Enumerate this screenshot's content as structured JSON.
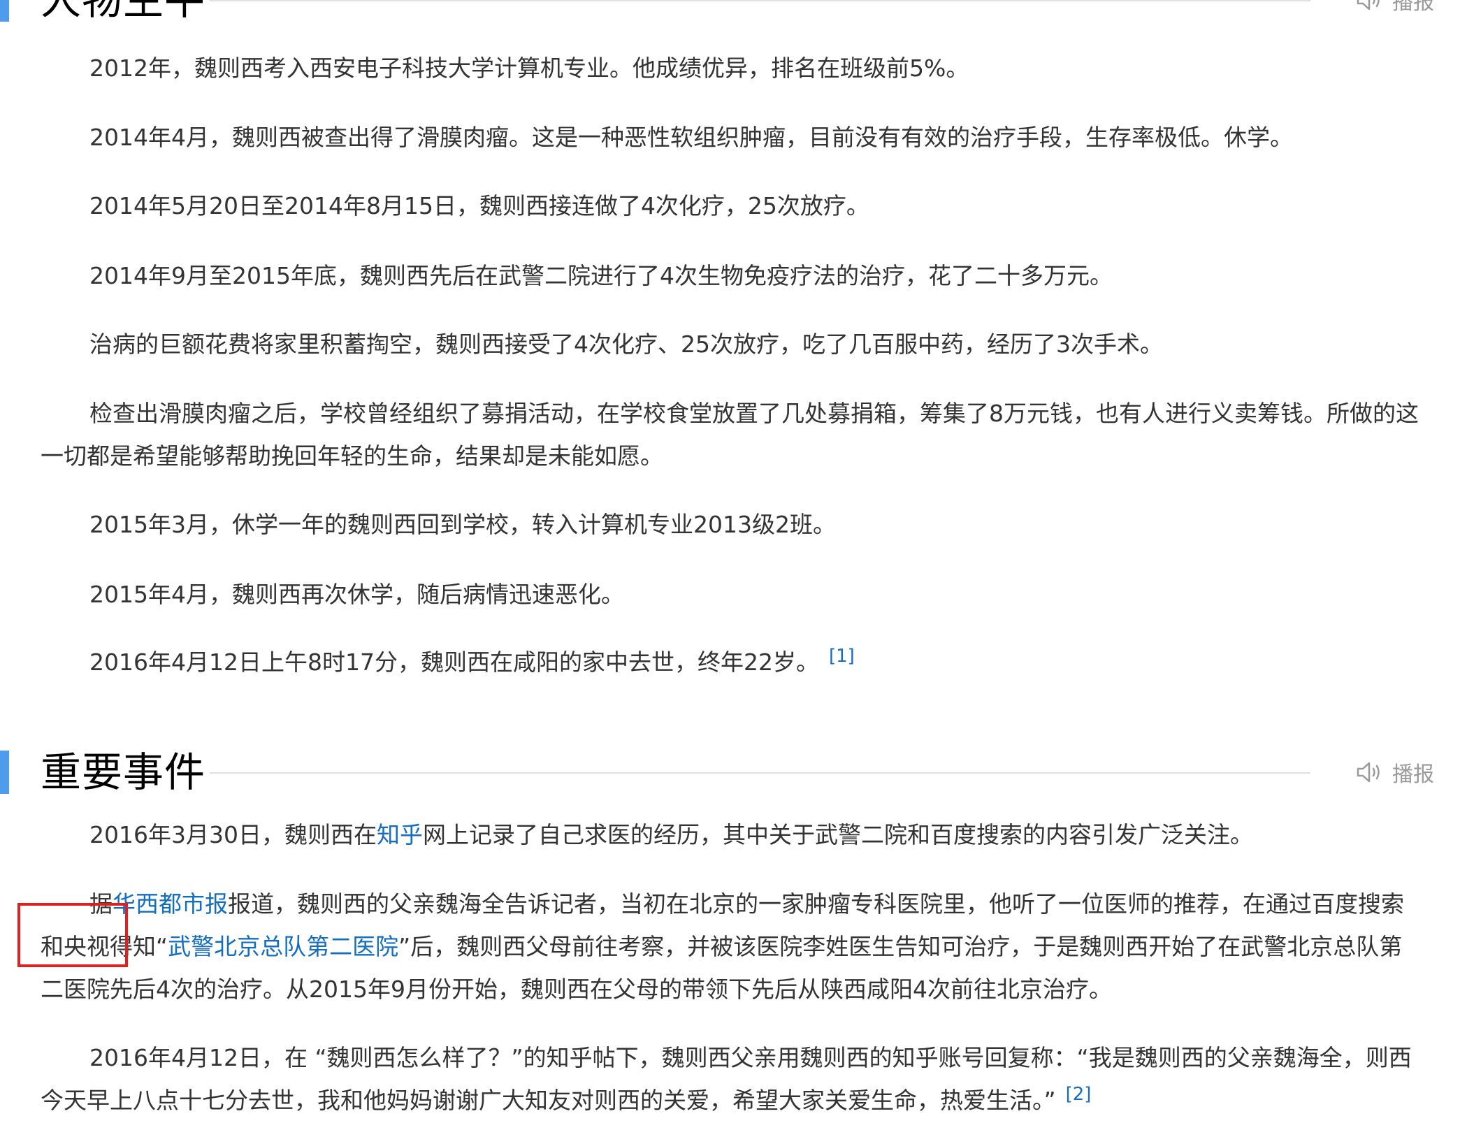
{
  "sections": [
    {
      "title": "人物生平",
      "listen_label": "播报"
    },
    {
      "title": "重要事件",
      "listen_label": "播报"
    }
  ],
  "life": {
    "p1": "2012年，魏则西考入西安电子科技大学计算机专业。他成绩优异，排名在班级前5%。",
    "p2": "2014年4月，魏则西被查出得了滑膜肉瘤。这是一种恶性软组织肿瘤，目前没有有效的治疗手段，生存率极低。休学。",
    "p3": "2014年5月20日至2014年8月15日，魏则西接连做了4次化疗，25次放疗。",
    "p4": "2014年9月至2015年底，魏则西先后在武警二院进行了4次生物免疫疗法的治疗，花了二十多万元。",
    "p5": "治病的巨额花费将家里积蓄掏空，魏则西接受了4次化疗、25次放疗，吃了几百服中药，经历了3次手术。",
    "p6": "检查出滑膜肉瘤之后，学校曾经组织了募捐活动，在学校食堂放置了几处募捐箱，筹集了8万元钱，也有人进行义卖筹钱。所做的这一切都是希望能够帮助挽回年轻的生命，结果却是未能如愿。",
    "p7": "2015年3月，休学一年的魏则西回到学校，转入计算机专业2013级2班。",
    "p8": "2015年4月，魏则西再次休学，随后病情迅速恶化。",
    "p9": "2016年4月12日上午8时17分，魏则西在咸阳的家中去世，终年22岁。",
    "p9_ref": "[1]"
  },
  "events": {
    "e1_before": "2016年3月30日，魏则西在",
    "e1_link": "知乎",
    "e1_after": "网上记录了自己求医的经历，其中关于武警二院和百度搜索的内容引发广泛关注。",
    "e2_before": "据",
    "e2_link1": "华西都市报",
    "e2_mid1": "报道，魏则西的父亲魏海全告诉记者，当初在北京的一家肿瘤专科医院里，他听了一位医师的推荐，在通过百度搜索和央视得知“",
    "e2_link2": "武警北京总队第二医院",
    "e2_after": "”后，魏则西父母前往考察，并被该医院李姓医生告知可治疗，于是魏则西开始了在武警北京总队第二医院先后4次的治疗。从2015年9月份开始，魏则西在父母的带领下先后从陕西咸阳4次前往北京治疗。",
    "e3": "2016年4月12日，在 “魏则西怎么样了？”的知乎帖下，魏则西父亲用魏则西的知乎账号回复称：“我是魏则西的父亲魏海全，则西今天早上八点十七分去世，我和他妈妈谢谢广大知友对则西的关爱，希望大家关爱生命，热爱生活。”",
    "e3_ref": "[2]"
  },
  "colors": {
    "accent": "#4f9cee",
    "link": "#136ec2",
    "highlight_box": "#e02020"
  },
  "icons": {
    "listen": "speaker-icon"
  }
}
